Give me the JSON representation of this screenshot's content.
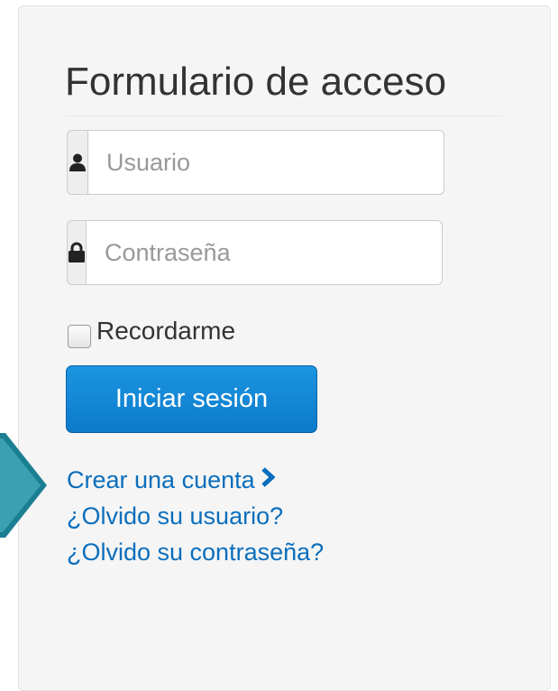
{
  "form": {
    "title": "Formulario de acceso",
    "username": {
      "placeholder": "Usuario",
      "value": ""
    },
    "password": {
      "placeholder": "Contraseña",
      "value": ""
    },
    "remember_label": "Recordarme",
    "remember_checked": false,
    "submit_label": "Iniciar sesión"
  },
  "links": {
    "create_account": "Crear una cuenta",
    "forgot_username": "¿Olvido su usuario?",
    "forgot_password": "¿Olvido su contraseña?"
  },
  "icons": {
    "username": "user-icon",
    "password": "lock-icon",
    "create_account": "chevron-right-icon",
    "pointer": "arrow-pointer-icon"
  },
  "colors": {
    "panel_bg": "#f5f5f5",
    "primary": "#0d7acb",
    "link": "#0b6ebc",
    "pointer": "#3aa1b3"
  }
}
